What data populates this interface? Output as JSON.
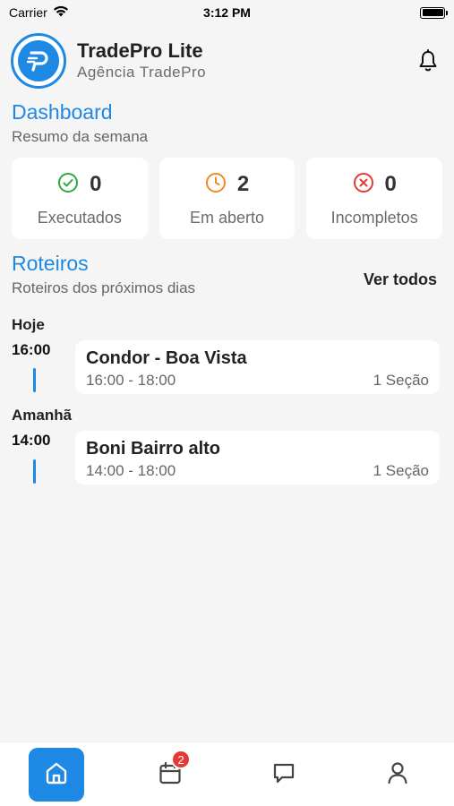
{
  "status_bar": {
    "carrier": "Carrier",
    "time": "3:12 PM"
  },
  "header": {
    "app_name": "TradePro Lite",
    "agency": "Agência TradePro"
  },
  "dashboard": {
    "title": "Dashboard",
    "subtitle": "Resumo da semana",
    "stats": [
      {
        "value": "0",
        "label": "Executados",
        "icon": "check-circle-icon",
        "color": "#2eaa3c"
      },
      {
        "value": "2",
        "label": "Em aberto",
        "icon": "clock-icon",
        "color": "#f08a24"
      },
      {
        "value": "0",
        "label": "Incompletos",
        "icon": "x-circle-icon",
        "color": "#e53935"
      }
    ]
  },
  "routes": {
    "title": "Roteiros",
    "subtitle": "Roteiros dos próximos dias",
    "view_all": "Ver todos",
    "days": [
      {
        "day": "Hoje",
        "time": "16:00",
        "name": "Condor - Boa Vista",
        "hours": "16:00 - 18:00",
        "sections": "1 Seção"
      },
      {
        "day": "Amanhã",
        "time": "14:00",
        "name": "Boni Bairro alto",
        "hours": "14:00 - 18:00",
        "sections": "1 Seção"
      }
    ]
  },
  "tab_bar": {
    "active_color": "#1e88e5",
    "calendar_badge": "2",
    "tabs": [
      "home-icon",
      "calendar-icon",
      "chat-icon",
      "profile-icon"
    ]
  }
}
